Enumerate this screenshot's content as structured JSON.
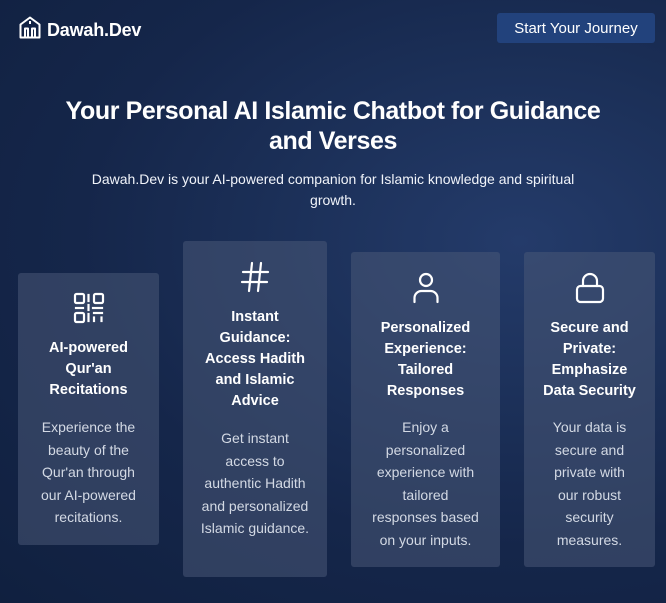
{
  "header": {
    "brand_icon": "mosque-icon",
    "brand_name": "Dawah.Dev",
    "cta_label": "Start Your Journey"
  },
  "hero": {
    "title": "Your Personal AI Islamic Chatbot for Guidance and Verses",
    "subtitle": "Dawah.Dev is your AI-powered companion for Islamic knowledge and spiritual growth."
  },
  "features": [
    {
      "icon": "qr-code-icon",
      "title": "AI-powered Qur'an Recitations",
      "description": "Experience the beauty of the Qur'an through our AI-powered recitations."
    },
    {
      "icon": "hash-icon",
      "title": "Instant Guidance: Access Hadith and Islamic Advice",
      "description": "Get instant access to authentic Hadith and personalized Islamic guidance."
    },
    {
      "icon": "user-icon",
      "title": "Personalized Experience: Tailored Responses",
      "description": "Enjoy a personalized experience with tailored responses based on your inputs."
    },
    {
      "icon": "lock-icon",
      "title": "Secure and Private: Emphasize Data Security",
      "description": "Your data is secure and private with our robust security measures."
    }
  ],
  "colors": {
    "background": "#15264a",
    "cta_background": "#22427c",
    "card_background": "#485876",
    "text": "#ffffff",
    "muted_text": "#d3d9e4"
  }
}
